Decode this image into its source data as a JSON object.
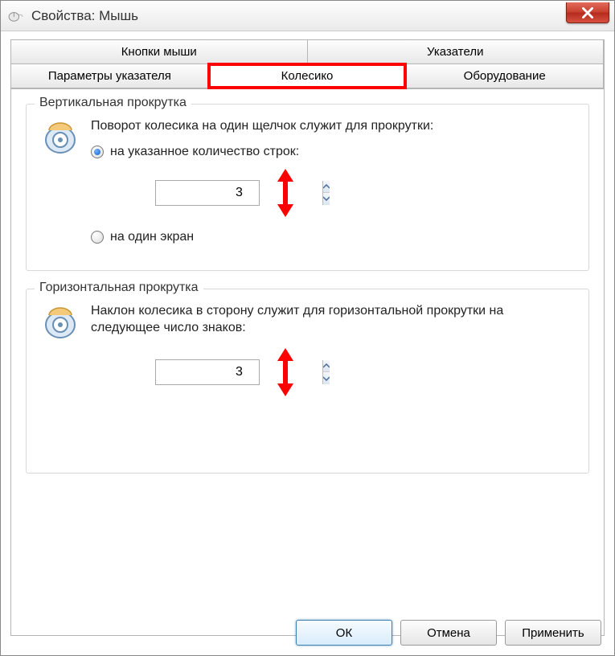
{
  "titlebar": {
    "title": "Свойства: Мышь"
  },
  "tabs": {
    "row1": [
      "Кнопки мыши",
      "Указатели"
    ],
    "row2": [
      "Параметры указателя",
      "Колесико",
      "Оборудование"
    ],
    "active": "Колесико"
  },
  "vertical_group": {
    "title": "Вертикальная прокрутка",
    "text": "Поворот колесика на один щелчок служит для прокрутки:",
    "radio_lines": "на указанное количество строк:",
    "radio_screen": "на один экран",
    "lines_value": "3"
  },
  "horizontal_group": {
    "title": "Горизонтальная прокрутка",
    "text": "Наклон колесика в сторону служит для горизонтальной прокрутки на следующее число знаков:",
    "chars_value": "3"
  },
  "buttons": {
    "ok": "ОК",
    "cancel": "Отмена",
    "apply": "Применить"
  }
}
